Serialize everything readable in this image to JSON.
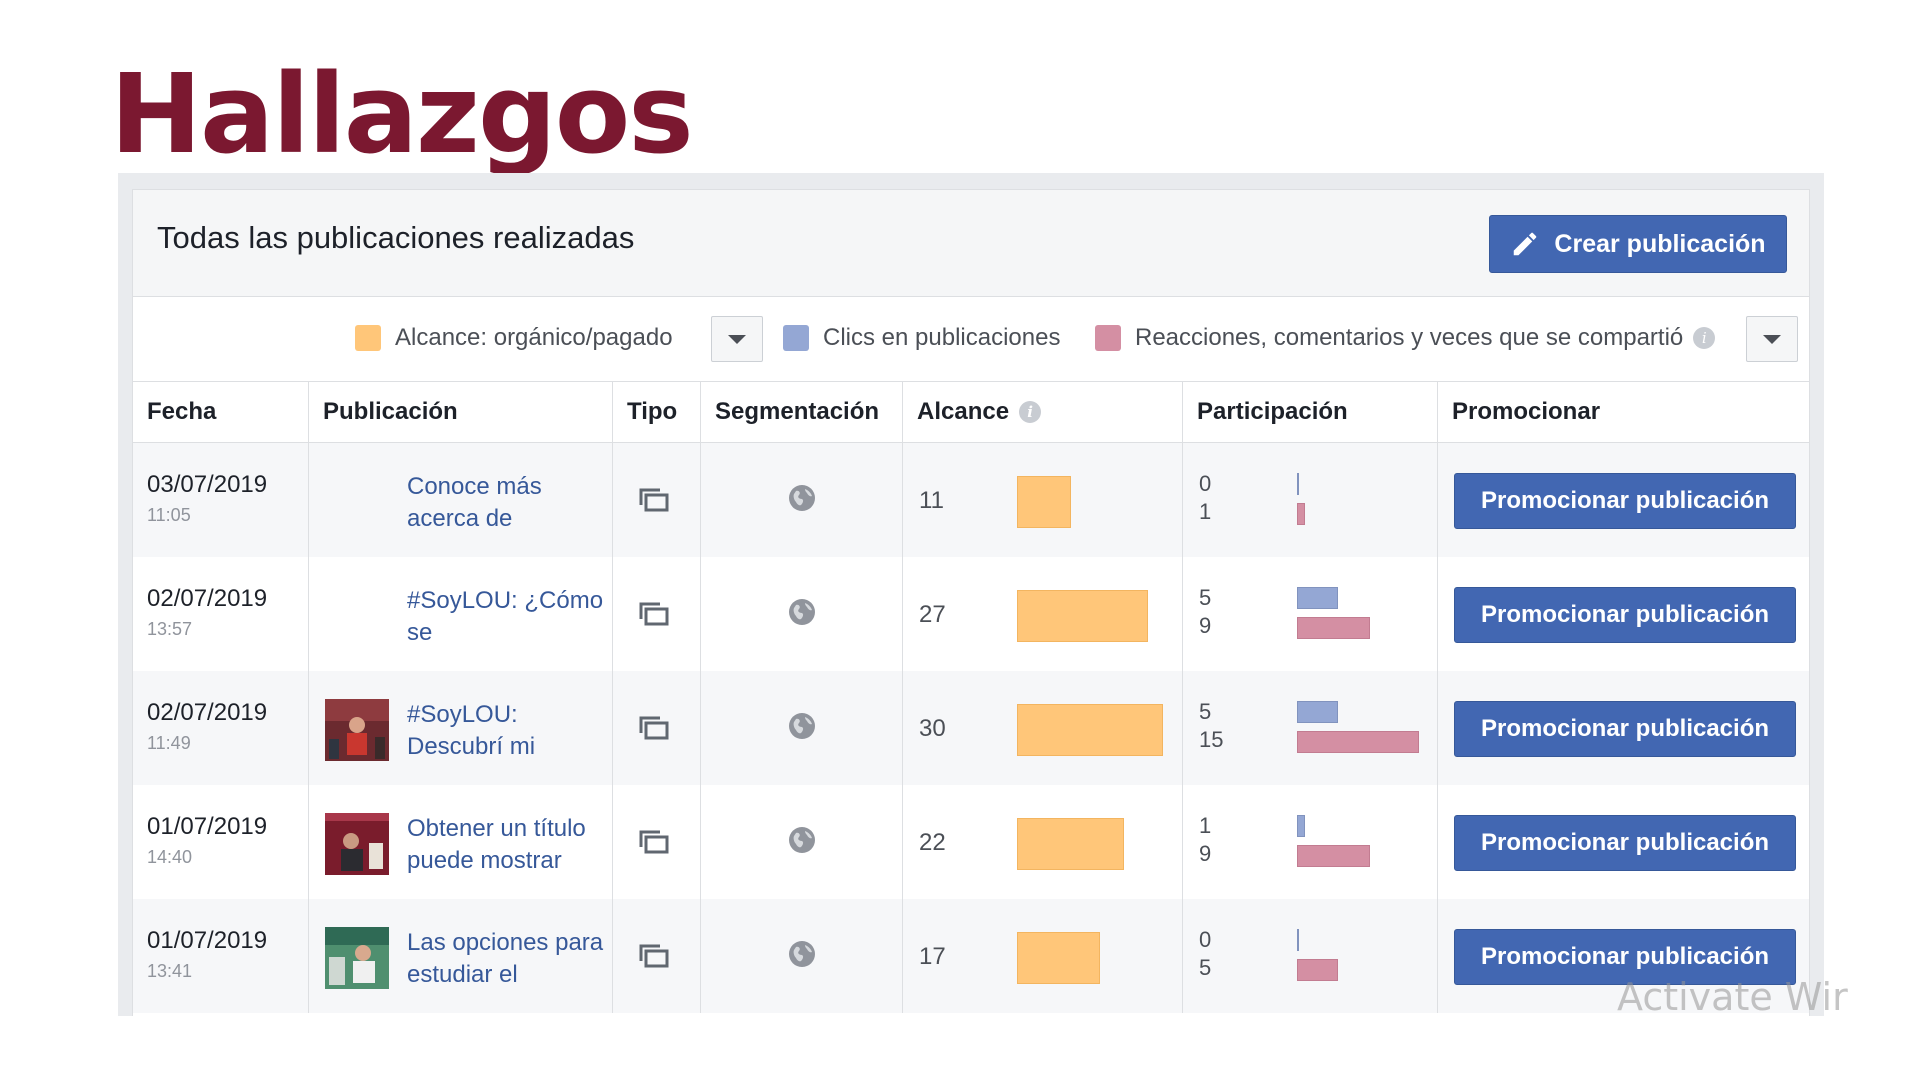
{
  "slide": {
    "title": "Hallazgos",
    "title_color": "#7b1830"
  },
  "panel": {
    "title": "Todas las publicaciones realizadas",
    "create_button_label": "Crear publicación"
  },
  "legend": {
    "reach_label": "Alcance: orgánico/pagado",
    "clicks_label": "Clics en publicaciones",
    "reactions_label": "Reacciones, comentarios y veces que se compartió",
    "reach_color": "#ffc679",
    "clicks_color": "#94a7d4",
    "reactions_color": "#d48fa3"
  },
  "table": {
    "headers": {
      "date": "Fecha",
      "post": "Publicación",
      "type": "Tipo",
      "targeting": "Segmentación",
      "reach": "Alcance",
      "engagement": "Participación",
      "promote": "Promocionar"
    },
    "max_reach": 30,
    "max_engagement": 15,
    "rows": [
      {
        "date": "03/07/2019",
        "time": "11:05",
        "text": "Conoce más acerca de",
        "thumbnail": "none",
        "type_icon": "album-icon",
        "targeting_icon": "globe-icon",
        "reach": "11",
        "clicks": "0",
        "reactions": "1",
        "promote_label": "Promocionar publicación"
      },
      {
        "date": "02/07/2019",
        "time": "13:57",
        "text": "#SoyLOU: ¿Cómo se",
        "thumbnail": "none",
        "type_icon": "album-icon",
        "targeting_icon": "globe-icon",
        "reach": "27",
        "clicks": "5",
        "reactions": "9",
        "promote_label": "Promocionar publicación"
      },
      {
        "date": "02/07/2019",
        "time": "11:49",
        "text": "#SoyLOU: Descubrí mi",
        "thumbnail": "photo",
        "type_icon": "album-icon",
        "targeting_icon": "globe-icon",
        "reach": "30",
        "clicks": "5",
        "reactions": "15",
        "promote_label": "Promocionar publicación"
      },
      {
        "date": "01/07/2019",
        "time": "14:40",
        "text": "Obtener un título puede mostrar",
        "thumbnail": "photo",
        "type_icon": "album-icon",
        "targeting_icon": "globe-icon",
        "reach": "22",
        "clicks": "1",
        "reactions": "9",
        "promote_label": "Promocionar publicación"
      },
      {
        "date": "01/07/2019",
        "time": "13:41",
        "text": "Las opciones para estudiar el",
        "thumbnail": "photo",
        "type_icon": "album-icon",
        "targeting_icon": "globe-icon",
        "reach": "17",
        "clicks": "0",
        "reactions": "5",
        "promote_label": "Promocionar publicación"
      }
    ]
  },
  "watermark": "Activate Wir"
}
